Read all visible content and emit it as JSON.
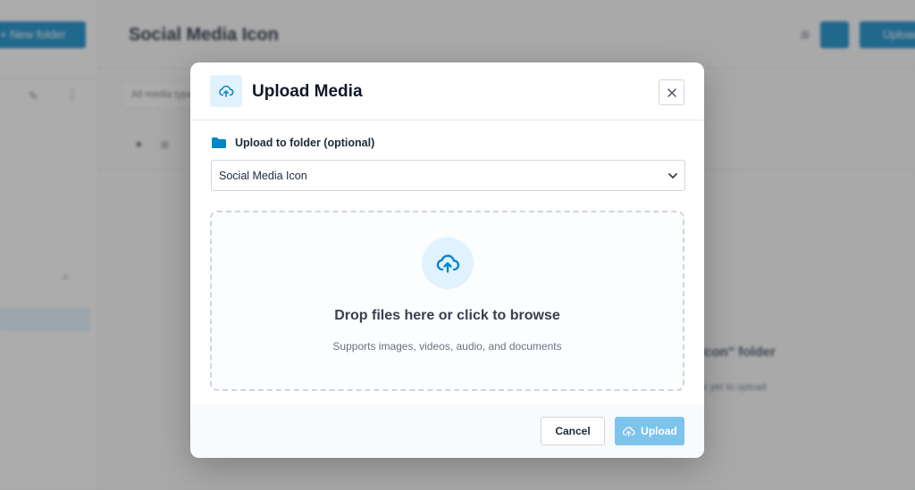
{
  "background": {
    "sidebar": {
      "new_folder_label": "+ New folder"
    },
    "header": {
      "title": "Social Media Icon",
      "upload_label": "Upload"
    },
    "filter_placeholder": "All media types",
    "empty_state": {
      "title": "Icon\" folder",
      "subtitle": "s yet to upload"
    }
  },
  "modal": {
    "title": "Upload Media",
    "folder_label": "Upload to folder (optional)",
    "folder_select": {
      "selected": "Social Media Icon",
      "options": [
        "Social Media Icon"
      ]
    },
    "dropzone": {
      "title": "Drop files here or click to browse",
      "subtitle": "Supports images, videos, audio, and documents"
    },
    "footer": {
      "cancel_label": "Cancel",
      "upload_label": "Upload"
    }
  },
  "icons": {
    "header": "cloud-upload-icon",
    "close": "close-icon",
    "folder": "folder-icon",
    "chevron": "chevron-down-icon",
    "dropzone": "cloud-upload-icon",
    "upload_button": "cloud-upload-icon"
  },
  "colors": {
    "accent": "#0284c7",
    "accent_light": "#e0f2fe",
    "upload_button_disabled": "#7cc4ec",
    "folder_icon": "#0284c7"
  }
}
